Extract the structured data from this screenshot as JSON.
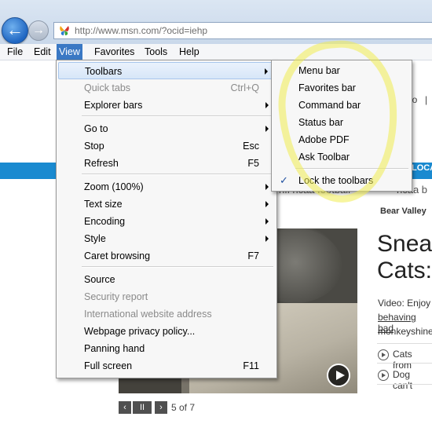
{
  "browser": {
    "url": "http://www.msn.com/?ocid=iehp",
    "back_icon": "arrow-left",
    "forward_icon": "arrow-right",
    "accent_color": "#3a78c4"
  },
  "menubar": {
    "file": "File",
    "edit": "Edit",
    "view": "View",
    "favorites": "Favorites",
    "tools": "Tools",
    "help": "Help"
  },
  "view_menu": {
    "items": [
      {
        "label": "Toolbars",
        "shortcut": "",
        "submenu": true,
        "disabled": false
      },
      {
        "label": "Quick tabs",
        "shortcut": "Ctrl+Q",
        "submenu": false,
        "disabled": true
      },
      {
        "label": "Explorer bars",
        "shortcut": "",
        "submenu": true,
        "disabled": false
      },
      {
        "label": "Go to",
        "shortcut": "",
        "submenu": true,
        "disabled": false
      },
      {
        "label": "Stop",
        "shortcut": "Esc",
        "submenu": false,
        "disabled": false
      },
      {
        "label": "Refresh",
        "shortcut": "F5",
        "submenu": false,
        "disabled": false
      },
      {
        "label": "Zoom (100%)",
        "shortcut": "",
        "submenu": true,
        "disabled": false
      },
      {
        "label": "Text size",
        "shortcut": "",
        "submenu": true,
        "disabled": false
      },
      {
        "label": "Encoding",
        "shortcut": "",
        "submenu": true,
        "disabled": false
      },
      {
        "label": "Style",
        "shortcut": "",
        "submenu": true,
        "disabled": false
      },
      {
        "label": "Caret browsing",
        "shortcut": "F7",
        "submenu": false,
        "disabled": false
      },
      {
        "label": "Source",
        "shortcut": "",
        "submenu": false,
        "disabled": false
      },
      {
        "label": "Security report",
        "shortcut": "",
        "submenu": false,
        "disabled": true
      },
      {
        "label": "International website address",
        "shortcut": "",
        "submenu": false,
        "disabled": true
      },
      {
        "label": "Webpage privacy policy...",
        "shortcut": "",
        "submenu": false,
        "disabled": false
      },
      {
        "label": "Panning hand",
        "shortcut": "",
        "submenu": false,
        "disabled": false
      },
      {
        "label": "Full screen",
        "shortcut": "F11",
        "submenu": false,
        "disabled": false
      }
    ]
  },
  "toolbars_submenu": {
    "items": [
      {
        "label": "Menu bar",
        "checked": false
      },
      {
        "label": "Favorites bar",
        "checked": false
      },
      {
        "label": "Command bar",
        "checked": false
      },
      {
        "label": "Status bar",
        "checked": false
      },
      {
        "label": "Adobe PDF",
        "checked": false
      },
      {
        "label": "Ask Toolbar",
        "checked": false
      },
      {
        "label": "Lock the toolbars",
        "checked": true
      }
    ],
    "check_glyph": "✓"
  },
  "page": {
    "nav_fragment_io": "io",
    "nav_fragment_pipe": "|",
    "loca_tab": "LOCA",
    "nfl_fragment": "nfl  ncaa football",
    "ncaa_fragment": "ncaa b",
    "bear_valley": "Bear Valley",
    "headline_line1": "Snea",
    "headline_line2": "Cats:",
    "video_text": "Video: Enjoy",
    "behaving_text": "behaving bad",
    "monkey_text": "monkeyshine",
    "related_link_1": "Cats from",
    "related_link_2": "Dog can't",
    "gallery_position": "5 of 7",
    "gallery_prev": "‹",
    "gallery_pause": "II",
    "gallery_next": "›",
    "strip_color": "#1a8ad0"
  },
  "annotation": {
    "color": "#f0ec50"
  }
}
